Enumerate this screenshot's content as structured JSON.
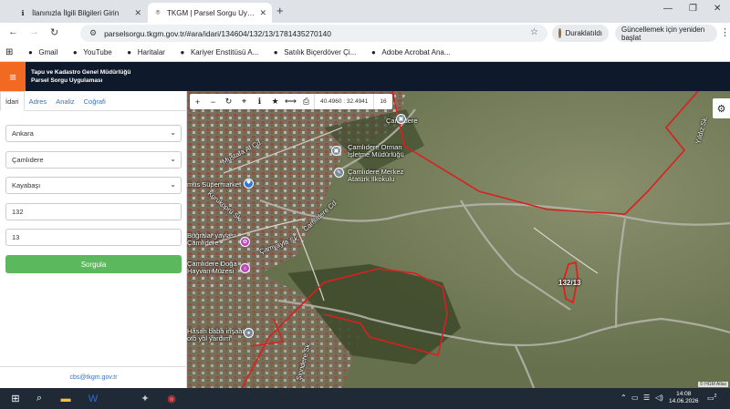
{
  "browser": {
    "tabs": [
      {
        "title": "İlanınızla İlgili Bilgileri Girin"
      },
      {
        "title": "TKGM | Parsel Sorgu Uygulama"
      }
    ],
    "url": "parselsorgu.tkgm.gov.tr/#ara/idari/134604/132/13/1781435270140",
    "paused_label": "Duraklatıldı",
    "update_label": "Güncellemek için yeniden başlat",
    "bookmarks": [
      "Gmail",
      "YouTube",
      "Haritalar",
      "Kariyer Enstitüsü A...",
      "Satılık Biçerdöver Çi...",
      "Adobe Acrobat Ana..."
    ]
  },
  "app": {
    "title_line1": "Tapu ve Kadastro Genel Müdürlüğü",
    "title_line2": "Parsel Sorgu Uygulaması"
  },
  "panel": {
    "tabs": [
      "İdari",
      "Adres",
      "Analiz",
      "Coğrafi"
    ],
    "active_tab": "İdari",
    "il": "Ankara",
    "ilce": "Çamlıdere",
    "mahalle": "Kayabaşı",
    "ada": "132",
    "parsel": "13",
    "query_button": "Sorgula",
    "email": "cbs@tkgm.gov.tr"
  },
  "map": {
    "coords": "40.4960 : 32.4941",
    "zoom": "16",
    "parcel_label": "132/13",
    "attribution": "© HGM Atlas",
    "labels": [
      "Çamlıdere",
      "Mustafa Al Cd.",
      "Çamlıdere Orman İşletme Müdürlüğü",
      "Çamlıdere Merkez Atatürk İlkokulu",
      "mus Süpermarket",
      "Kuruköprü Sk.",
      "Camlıdere Cd.",
      "Buğralar yaylası Çamlıdere",
      "Çamyayla Sk.",
      "Çamlıdere Doğa Hayvan Müzesi",
      "Hasan baba inşaat oto yol yardım",
      "Şirindere Sk.",
      "Yıldız Sk."
    ]
  },
  "taskbar": {
    "time": "14:08",
    "date": "14.06.2026",
    "notif_count": "2"
  },
  "colors": {
    "header_bg": "#0e1a2b",
    "accent_orange": "#f26a21",
    "button_green": "#5cb85c",
    "parcel_red": "#d82020"
  }
}
